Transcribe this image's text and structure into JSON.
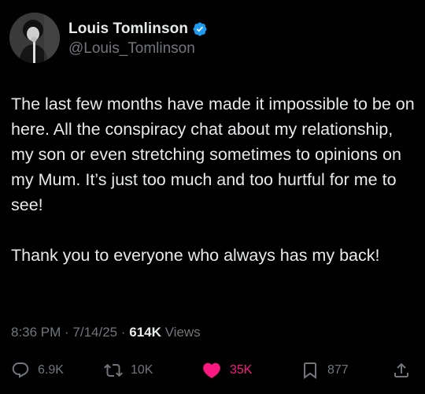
{
  "user": {
    "display_name": "Louis Tomlinson",
    "handle": "@Louis_Tomlinson",
    "verified": true
  },
  "tweet": {
    "paragraphs": [
      "The last few months have made it impossible to be on here. All the conspiracy chat about my relationship, my son or even stretching sometimes to opinions on my Mum. It’s just too much and too hurtful for me to see!",
      "Thank you to everyone who always has my back!"
    ]
  },
  "meta": {
    "time": "8:36 PM",
    "separator": " · ",
    "date": "7/14/25",
    "views_count": "614K",
    "views_label": "Views"
  },
  "actions": {
    "replies": "6.9K",
    "reposts": "10K",
    "likes": "35K",
    "bookmarks": "877"
  },
  "colors": {
    "background": "#000000",
    "text_primary": "#e7e9ea",
    "text_secondary": "#71767b",
    "like_active": "#f91880",
    "verified_badge": "#1d9bf0"
  }
}
